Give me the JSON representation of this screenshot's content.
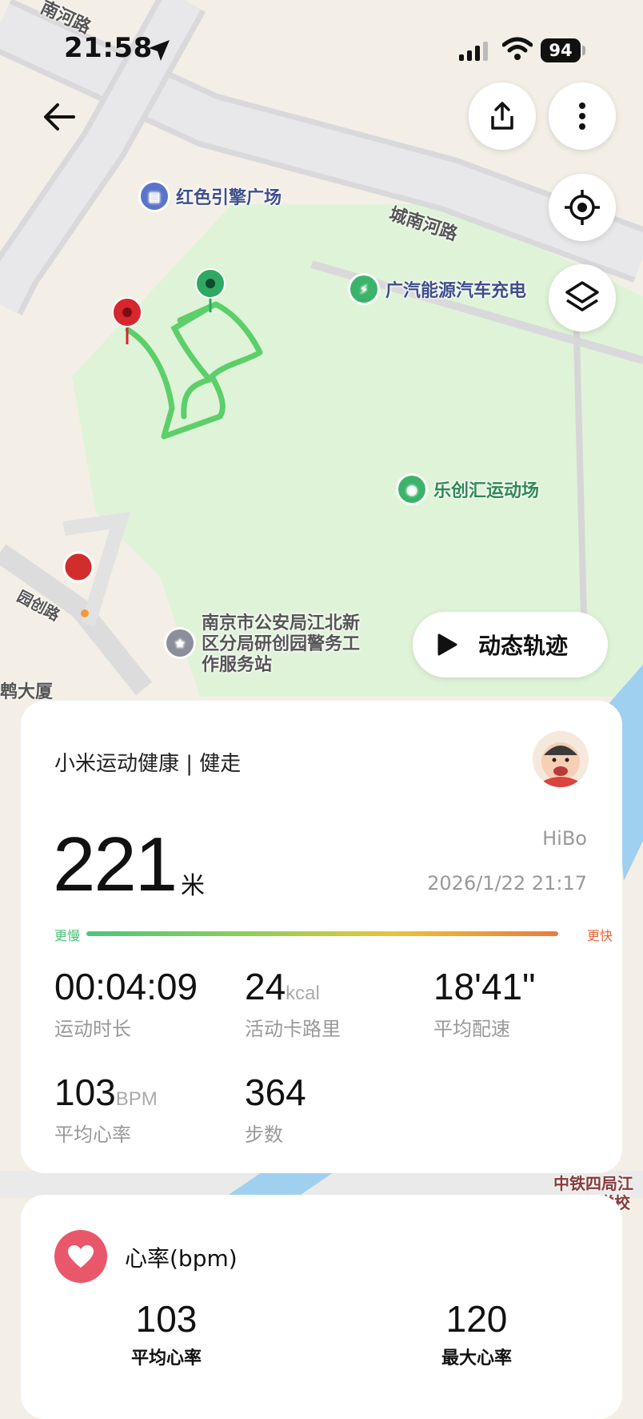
{
  "status_bar": {
    "time": "21:58",
    "battery": "94"
  },
  "map": {
    "pois": [
      {
        "name": "红色引擎广场"
      },
      {
        "name": "广汽能源汽车充电"
      },
      {
        "name": "乐创汇运动场"
      },
      {
        "name": "南京市公安局江北新区分局研创园警务工作服务站"
      }
    ],
    "roads": [
      "南河路",
      "城南河路",
      "园创路",
      "鹎大厦",
      "中铁四局江",
      "学校"
    ],
    "replay_label": "动态轨迹"
  },
  "summary": {
    "source": "小米运动健康 | 健走",
    "distance": "221",
    "distance_unit": "米",
    "username": "HiBo",
    "datetime": "2026/1/22 21:17",
    "pace_slow": "更慢",
    "pace_fast": "更快",
    "metrics": [
      {
        "value": "00:04:09",
        "unit": "",
        "label": "运动时长"
      },
      {
        "value": "24",
        "unit": "kcal",
        "label": "活动卡路里"
      },
      {
        "value": "18'41\"",
        "unit": "",
        "label": "平均配速"
      },
      {
        "value": "103",
        "unit": "BPM",
        "label": "平均心率"
      },
      {
        "value": "364",
        "unit": "",
        "label": "步数"
      }
    ]
  },
  "heart_rate": {
    "title": "心率(bpm)",
    "avg_value": "103",
    "avg_label": "平均心率",
    "max_value": "120",
    "max_label": "最大心率"
  },
  "colors": {
    "track": "#5ccf6a",
    "start_pin": "#2fa864",
    "end_pin": "#d8262e",
    "heart": "#e9576b",
    "park": "#dff3d8"
  }
}
